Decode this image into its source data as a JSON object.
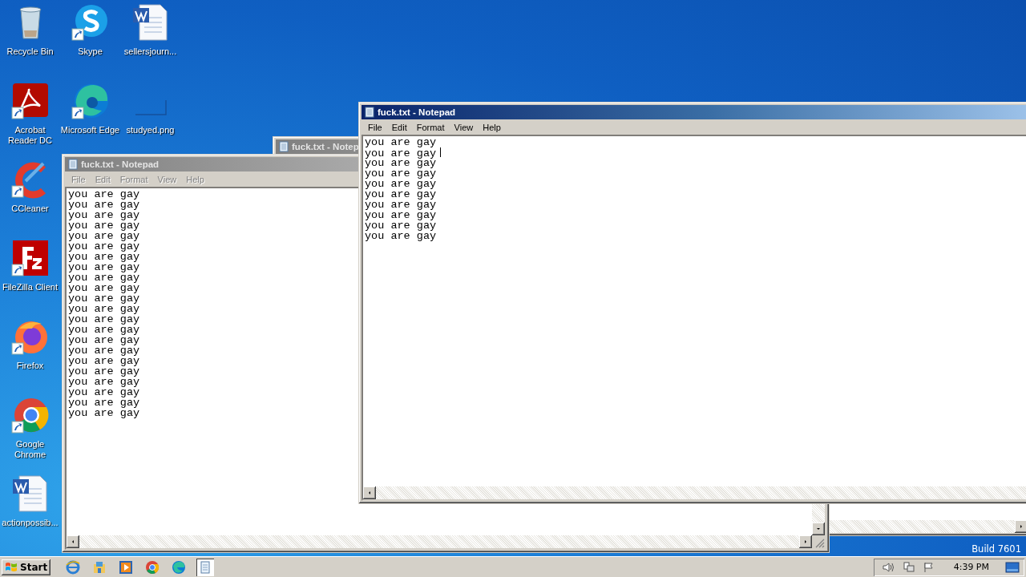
{
  "desktop_icons": [
    {
      "label": "Recycle Bin"
    },
    {
      "label": "Acrobat Reader DC"
    },
    {
      "label": "CCleaner"
    },
    {
      "label": "FileZilla Client"
    },
    {
      "label": "Firefox"
    },
    {
      "label": "Google Chrome"
    },
    {
      "label": "actionpossib..."
    },
    {
      "label": "Skype"
    },
    {
      "label": "Microsoft Edge"
    },
    {
      "label": "sellersjourn..."
    },
    {
      "label": "studyed.png"
    }
  ],
  "windows": [
    {
      "title": "fuck.txt - Notep",
      "active": false
    },
    {
      "title": "fuck.txt - Notepad",
      "active": false,
      "menu": [
        "File",
        "Edit",
        "Format",
        "View",
        "Help"
      ],
      "lines": [
        {
          "text": "you are gay",
          "caret": false
        },
        {
          "text": "you are gay",
          "caret": false
        },
        {
          "text": "you are gay",
          "caret": false
        },
        {
          "text": "you are gay",
          "caret": false
        },
        {
          "text": "you are gay",
          "caret": false
        },
        {
          "text": "you are gay",
          "caret": false
        },
        {
          "text": "you are gay",
          "caret": false
        },
        {
          "text": "you are gay",
          "caret": false
        },
        {
          "text": "you are gay",
          "caret": false
        },
        {
          "text": "you are gay",
          "caret": false
        },
        {
          "text": "you are gay",
          "caret": false
        },
        {
          "text": "you are gay",
          "caret": false
        },
        {
          "text": "you are gay",
          "caret": false
        },
        {
          "text": "you are gay",
          "caret": false
        },
        {
          "text": "you are gay",
          "caret": false
        },
        {
          "text": "you are gay",
          "caret": false
        },
        {
          "text": "you are gay",
          "caret": false
        },
        {
          "text": "you are gay",
          "caret": false
        },
        {
          "text": "you are gay",
          "caret": false
        },
        {
          "text": "you are gay",
          "caret": false
        },
        {
          "text": "you are gay",
          "caret": false
        },
        {
          "text": "you are gay",
          "caret": false
        }
      ]
    },
    {
      "title": "fuck.txt - Notepad",
      "active": true,
      "menu": [
        "File",
        "Edit",
        "Format",
        "View",
        "Help"
      ],
      "lines": [
        {
          "text": "you are gay",
          "caret": false
        },
        {
          "text": "you are gay",
          "caret": true
        },
        {
          "text": "you are gay",
          "caret": false
        },
        {
          "text": "you are gay",
          "caret": false
        },
        {
          "text": "you are gay",
          "caret": false
        },
        {
          "text": "you are gay",
          "caret": false
        },
        {
          "text": "you are gay",
          "caret": false
        },
        {
          "text": "you are gay",
          "caret": false
        },
        {
          "text": "you are gay",
          "caret": false
        },
        {
          "text": "you are gay",
          "caret": false
        }
      ]
    }
  ],
  "build_label": "Build 7601",
  "taskbar": {
    "start": "Start",
    "notepad_button": {
      "selected": true
    },
    "clock": "4:39 PM"
  }
}
